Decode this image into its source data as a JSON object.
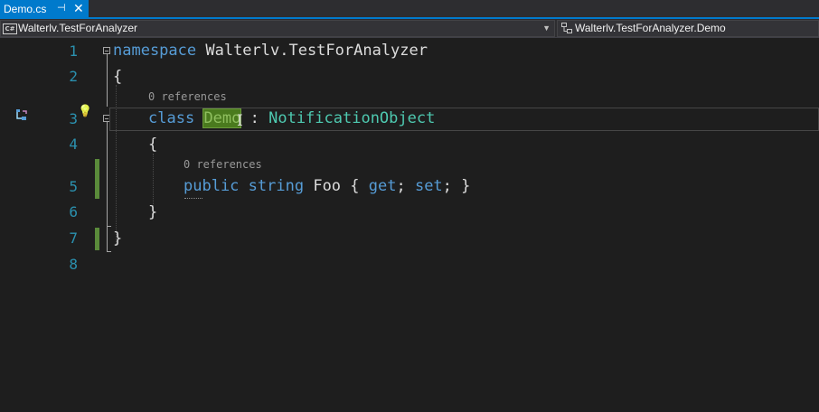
{
  "tab": {
    "title": "Demo.cs",
    "pin_glyph": "⊣",
    "close_glyph": "✕"
  },
  "navbar": {
    "project": "Walterlv.TestForAnalyzer",
    "project_icon": "C#",
    "type": "Walterlv.TestForAnalyzer.Demo"
  },
  "editor": {
    "line_numbers": [
      "1",
      "2",
      "3",
      "4",
      "5",
      "6",
      "7",
      "8"
    ],
    "line1": {
      "kw": "namespace",
      "rest": " Walterlv.TestForAnalyzer"
    },
    "line2": "{",
    "lens1": "0 references",
    "line3": {
      "kw": "class",
      "name": "Demo",
      "colon": " : ",
      "base": "NotificationObject"
    },
    "line4": "{",
    "lens2": "0 references",
    "line5": {
      "kw1": "public",
      "kw2": "string",
      "name": " Foo { ",
      "get": "get",
      "mid": "; ",
      "set": "set",
      "end": "; }"
    },
    "line6": "}",
    "line7": "}",
    "lightbulb": "💡",
    "cursor_glyph": "I"
  },
  "colors": {
    "accent": "#007acc",
    "keyword": "#569cd6",
    "type": "#4ec9b0",
    "line_number": "#2b91af",
    "change_bar": "#5a8a3a"
  }
}
